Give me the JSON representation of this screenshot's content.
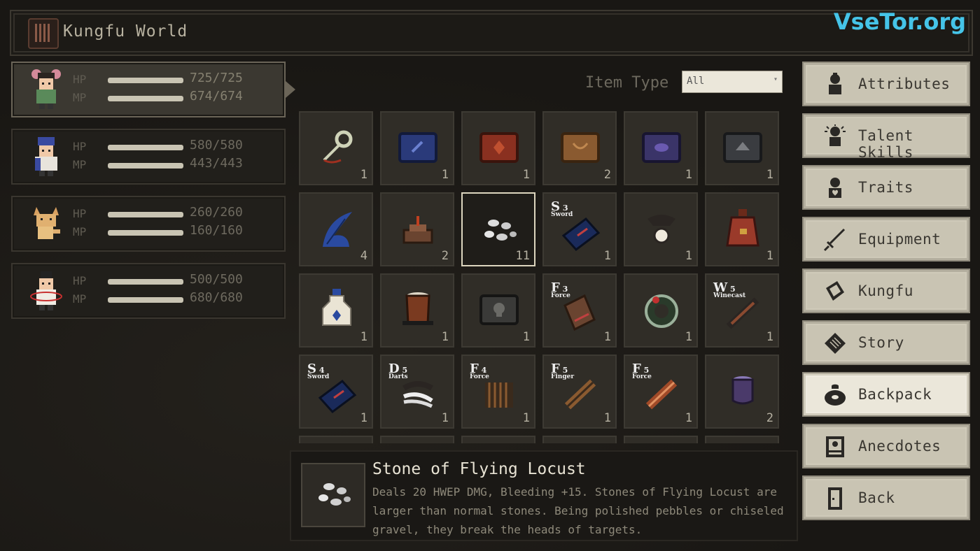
{
  "header": {
    "title": "Kungfu World",
    "watermark": "VseTor.org"
  },
  "party": [
    {
      "hp_label": "HP",
      "mp_label": "MP",
      "hp": "725/725",
      "mp": "674/674",
      "hp_fraction": 1.0,
      "mp_fraction": 1.0,
      "active": true
    },
    {
      "hp_label": "HP",
      "mp_label": "MP",
      "hp": "580/580",
      "mp": "443/443",
      "hp_fraction": 1.0,
      "mp_fraction": 1.0,
      "active": false
    },
    {
      "hp_label": "HP",
      "mp_label": "MP",
      "hp": "260/260",
      "mp": "160/160",
      "hp_fraction": 1.0,
      "mp_fraction": 1.0,
      "active": false
    },
    {
      "hp_label": "HP",
      "mp_label": "MP",
      "hp": "500/500",
      "mp": "680/680",
      "hp_fraction": 1.0,
      "mp_fraction": 1.0,
      "active": false
    }
  ],
  "filter": {
    "label": "Item Type",
    "selected": "All"
  },
  "items": [
    {
      "icon": "rope-dart-icon",
      "count": "1"
    },
    {
      "icon": "blue-manual-icon",
      "count": "1"
    },
    {
      "icon": "red-manual-icon",
      "count": "1"
    },
    {
      "icon": "brown-manual-icon",
      "count": "2"
    },
    {
      "icon": "purple-manual-icon",
      "count": "1"
    },
    {
      "icon": "dark-manual-icon",
      "count": "1"
    },
    {
      "icon": "blue-feather-icon",
      "count": "4"
    },
    {
      "icon": "incense-burner-icon",
      "count": "2"
    },
    {
      "icon": "stones-icon",
      "count": "11",
      "selected": true
    },
    {
      "icon": "sword-book-icon",
      "count": "1",
      "tag_letter": "S",
      "tag_level": "3",
      "tag_text": "Sword"
    },
    {
      "icon": "amulet-icon",
      "count": "1"
    },
    {
      "icon": "pouch-icon",
      "count": "1"
    },
    {
      "icon": "potion-bottle-icon",
      "count": "1"
    },
    {
      "icon": "wooden-barrel-icon",
      "count": "1"
    },
    {
      "icon": "skull-manual-icon",
      "count": "1"
    },
    {
      "icon": "force-book-icon",
      "count": "1",
      "tag_letter": "F",
      "tag_level": "3",
      "tag_text": "Force"
    },
    {
      "icon": "jade-ring-icon",
      "count": "1"
    },
    {
      "icon": "wine-scroll-icon",
      "count": "1",
      "tag_letter": "W",
      "tag_level": "5",
      "tag_text": "Winecast"
    },
    {
      "icon": "sword-book-icon",
      "count": "1",
      "tag_letter": "S",
      "tag_level": "4",
      "tag_text": "Sword"
    },
    {
      "icon": "darts-scroll-icon",
      "count": "1",
      "tag_letter": "D",
      "tag_level": "5",
      "tag_text": "Darts"
    },
    {
      "icon": "bamboo-scroll-icon",
      "count": "1",
      "tag_letter": "F",
      "tag_level": "4",
      "tag_text": "Force"
    },
    {
      "icon": "finger-scroll-icon",
      "count": "1",
      "tag_letter": "F",
      "tag_level": "5",
      "tag_text": "Finger"
    },
    {
      "icon": "force-scroll-icon",
      "count": "1",
      "tag_letter": "F",
      "tag_level": "5",
      "tag_text": "Force"
    },
    {
      "icon": "purple-jar-icon",
      "count": "2"
    }
  ],
  "detail": {
    "title": "Stone of Flying Locust",
    "description": "Deals 20 HWEP DMG, Bleeding +15. Stones of Flying Locust are larger than normal stones. Being polished pebbles or chiseled gravel, they break the heads of targets."
  },
  "menu": [
    {
      "label": "Attributes",
      "icon": "figure-icon"
    },
    {
      "label": "Talent Skills",
      "icon": "talent-icon"
    },
    {
      "label": "Traits",
      "icon": "heart-figure-icon"
    },
    {
      "label": "Equipment",
      "icon": "sword-icon"
    },
    {
      "label": "Kungfu",
      "icon": "book-icon"
    },
    {
      "label": "Story",
      "icon": "scroll-icon"
    },
    {
      "label": "Backpack",
      "icon": "backpack-icon",
      "active": true
    },
    {
      "label": "Anecdotes",
      "icon": "portrait-icon"
    },
    {
      "label": "Back",
      "icon": "door-icon"
    }
  ]
}
